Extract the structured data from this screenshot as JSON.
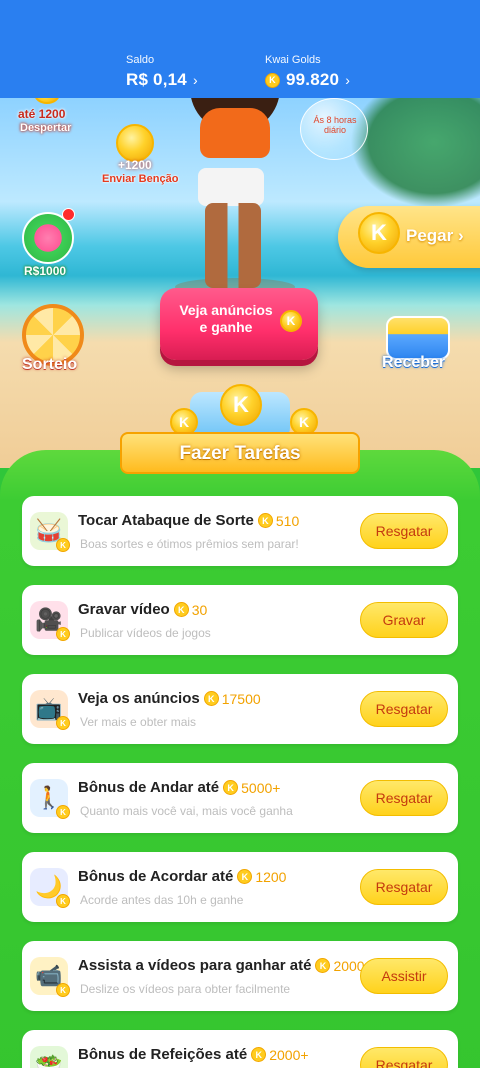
{
  "header": {
    "saldo_label": "Saldo",
    "saldo_value": "R$ 0,14",
    "golds_label": "Kwai Golds",
    "golds_value": "99.820",
    "coin_letter": "K"
  },
  "hero": {
    "despertar_amount": "até 1200",
    "despertar_label": "Despertar",
    "bencao_amount": "+1200",
    "bencao_label": "Enviar Benção",
    "bubble_text": "Ás 8 horas diário",
    "money_label": "R$1000",
    "sorteio_label": "Sorteio",
    "ads_button": "Veja anúncios e ganhe",
    "pegar_label": "Pegar",
    "receber_label": "Receber"
  },
  "tasks_title": "Fazer Tarefas",
  "tasks": [
    {
      "title": "Tocar Atabaque de Sorte",
      "reward": "510",
      "subtitle": "Boas sortes e ótimos prêmios sem parar!",
      "button": "Resgatar",
      "icon": "drum-icon"
    },
    {
      "title": "Gravar vídeo",
      "reward": "30",
      "subtitle": "Publicar vídeos de jogos",
      "button": "Gravar",
      "icon": "camera-icon"
    },
    {
      "title": "Veja os anúncios",
      "reward": "17500",
      "subtitle": "Ver mais e obter mais",
      "button": "Resgatar",
      "icon": "tv-icon"
    },
    {
      "title": "Bônus de Andar até",
      "reward": "5000+",
      "subtitle": "Quanto mais você vai, mais você ganha",
      "button": "Resgatar",
      "icon": "walking-person-icon"
    },
    {
      "title": "Bônus de Acordar até",
      "reward": "1200",
      "subtitle": "Acorde antes das 10h e ganhe",
      "button": "Resgatar",
      "icon": "moon-icon"
    },
    {
      "title": "Assista a vídeos para ganhar até",
      "reward": "2000",
      "subtitle": "Deslize os vídeos para obter facilmente",
      "button": "Assistir",
      "icon": "video-camera-icon"
    },
    {
      "title": "Bônus de Refeições até",
      "reward": "2000+",
      "subtitle": "",
      "button": "Resgatar",
      "icon": "meal-icon"
    }
  ]
}
